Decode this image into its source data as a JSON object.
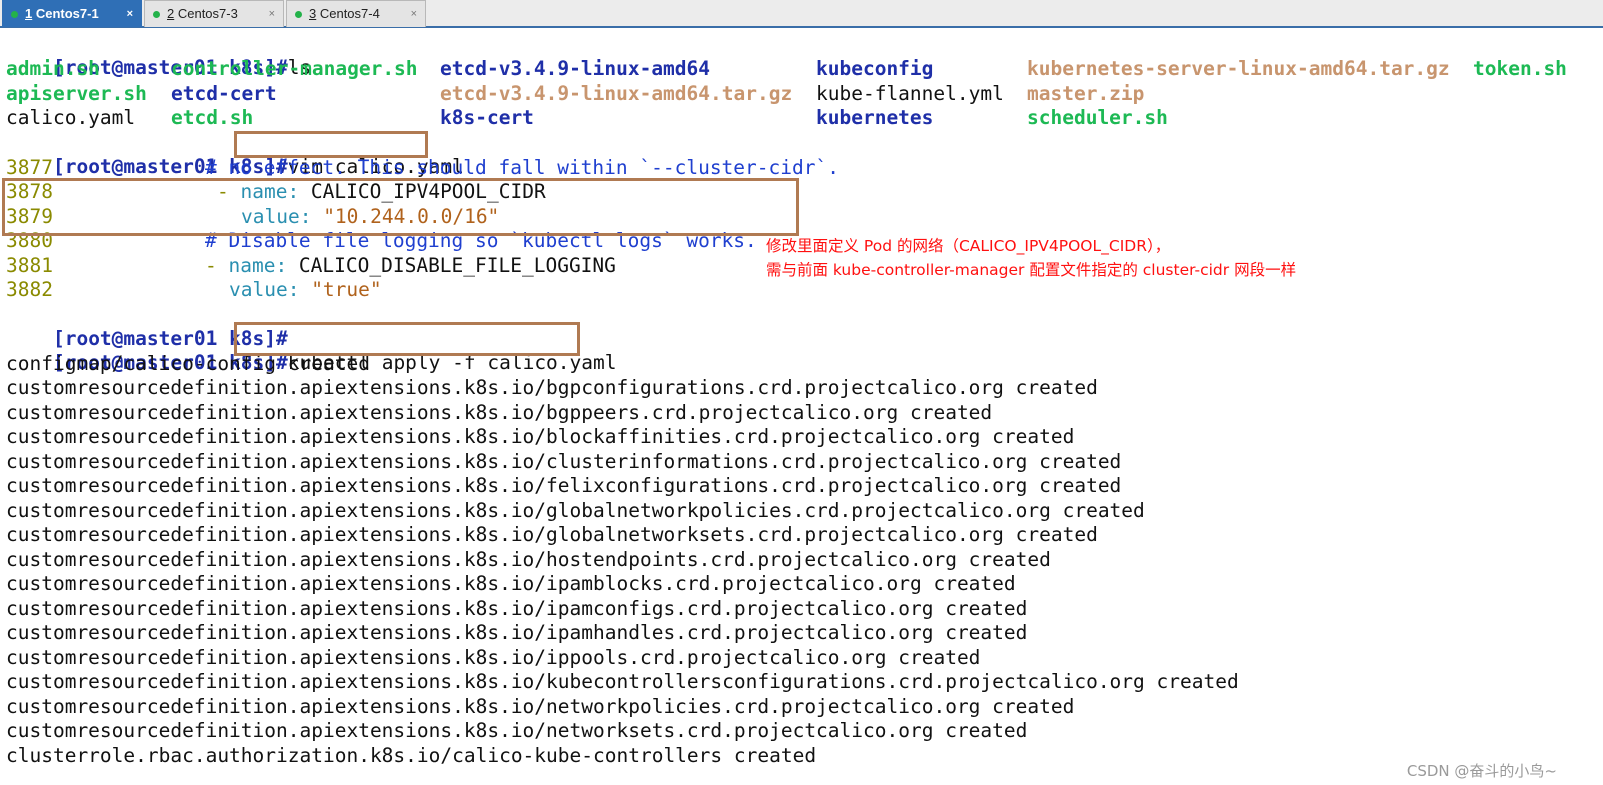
{
  "tabs": [
    {
      "num": "1",
      "name": " Centos7-1",
      "close": "×"
    },
    {
      "num": "2",
      "name": " Centos7-3",
      "close": "×"
    },
    {
      "num": "3",
      "name": " Centos7-4",
      "close": "×"
    }
  ],
  "prompt": "[root@master01 k8s]#",
  "cmd_ls": "ls",
  "ls": {
    "row1": [
      "admin.sh",
      "controller-manager.sh",
      "etcd-v3.4.9-linux-amd64",
      "kubeconfig",
      "kubernetes-server-linux-amd64.tar.gz",
      "token.sh"
    ],
    "row2": [
      "apiserver.sh",
      "etcd-cert",
      "etcd-v3.4.9-linux-amd64.tar.gz",
      "kube-flannel.yml",
      "master.zip"
    ],
    "row3": [
      "calico.yaml",
      "etcd.sh",
      "k8s-cert",
      "kubernetes",
      "scheduler.sh"
    ]
  },
  "cmd_vim": "vim calico.yaml",
  "yaml": {
    "l3877": {
      "num": "3877",
      "text": "# no effect. This should fall within `--cluster-cidr`."
    },
    "l3878": {
      "num": "3878",
      "dash": "- ",
      "key": "name:",
      "val": " CALICO_IPV4POOL_CIDR"
    },
    "l3879": {
      "num": "3879",
      "key": "value:",
      "val": " \"10.244.0.0/16\""
    },
    "l3880": {
      "num": "3880",
      "text": "# Disable file logging so `kubectl logs` works."
    },
    "l3881": {
      "num": "3881",
      "dash": "- ",
      "key": "name:",
      "val": " CALICO_DISABLE_FILE_LOGGING"
    },
    "l3882": {
      "num": "3882",
      "key": "value:",
      "val": " \"true\""
    }
  },
  "annotation": {
    "line1": "修改里面定义 Pod 的网络（CALICO_IPV4POOL_CIDR），",
    "line2": "需与前面 kube-controller-manager 配置文件指定的 cluster-cidr 网段一样"
  },
  "cmd_apply": "kubectl apply -f calico.yaml",
  "output": [
    "configmap/calico-config created",
    "customresourcedefinition.apiextensions.k8s.io/bgpconfigurations.crd.projectcalico.org created",
    "customresourcedefinition.apiextensions.k8s.io/bgppeers.crd.projectcalico.org created",
    "customresourcedefinition.apiextensions.k8s.io/blockaffinities.crd.projectcalico.org created",
    "customresourcedefinition.apiextensions.k8s.io/clusterinformations.crd.projectcalico.org created",
    "customresourcedefinition.apiextensions.k8s.io/felixconfigurations.crd.projectcalico.org created",
    "customresourcedefinition.apiextensions.k8s.io/globalnetworkpolicies.crd.projectcalico.org created",
    "customresourcedefinition.apiextensions.k8s.io/globalnetworksets.crd.projectcalico.org created",
    "customresourcedefinition.apiextensions.k8s.io/hostendpoints.crd.projectcalico.org created",
    "customresourcedefinition.apiextensions.k8s.io/ipamblocks.crd.projectcalico.org created",
    "customresourcedefinition.apiextensions.k8s.io/ipamconfigs.crd.projectcalico.org created",
    "customresourcedefinition.apiextensions.k8s.io/ipamhandles.crd.projectcalico.org created",
    "customresourcedefinition.apiextensions.k8s.io/ippools.crd.projectcalico.org created",
    "customresourcedefinition.apiextensions.k8s.io/kubecontrollersconfigurations.crd.projectcalico.org created",
    "customresourcedefinition.apiextensions.k8s.io/networkpolicies.crd.projectcalico.org created",
    "customresourcedefinition.apiextensions.k8s.io/networksets.crd.projectcalico.org created",
    "clusterrole.rbac.authorization.k8s.io/calico-kube-controllers created"
  ],
  "watermark": "CSDN @奋斗的小鸟~"
}
